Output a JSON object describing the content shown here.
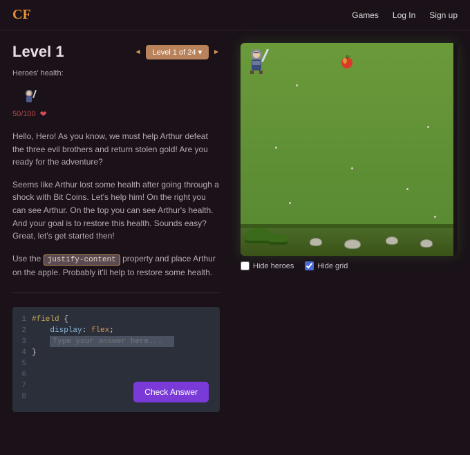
{
  "header": {
    "logo": "CF",
    "nav": {
      "games": "Games",
      "login": "Log In",
      "signup": "Sign up"
    }
  },
  "level": {
    "title": "Level 1",
    "nav_label": "Level 1 of 24 ▾",
    "arrow_left": "◄",
    "arrow_right": "►"
  },
  "health": {
    "label": "Heroes' health:",
    "value": "50/100"
  },
  "paragraphs": {
    "p1": "Hello, Hero! As you know, we must help Arthur defeat the three evil brothers and return stolen gold! Are you ready for the adventure?",
    "p2": "Seems like Arthur lost some health after going through a shock with Bit Coins. Let's help him! On the right you can see Arthur. On the top you can see Arthur's health. And your goal is to restore this health. Sounds easy? Great, let's get started then!",
    "p3a": "Use the ",
    "p3code": "justify-content",
    "p3b": " property and place Arthur on the apple. Probably it'll help to restore some health."
  },
  "editor": {
    "line1_sel": "#field ",
    "line1_brace": "{",
    "line2_indent": "    ",
    "line2_prop": "display",
    "line2_colon": ": ",
    "line2_val": "flex",
    "line2_semi": ";",
    "placeholder": "Type your answer here...",
    "line4_brace": "}",
    "check": "Check Answer"
  },
  "controls": {
    "hide_heroes": "Hide heroes",
    "hide_grid": "Hide grid"
  }
}
